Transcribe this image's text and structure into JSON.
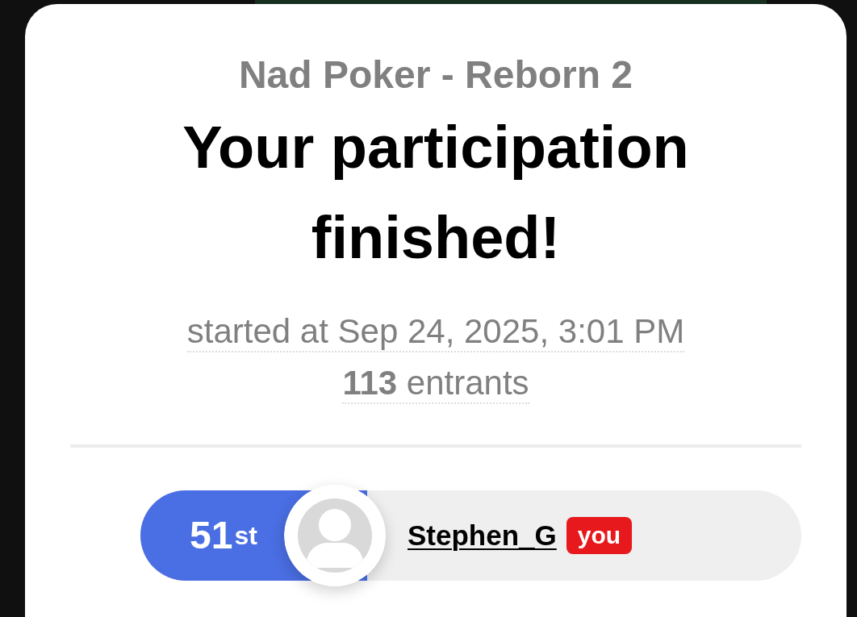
{
  "tournament": {
    "name": "Nad Poker - Reborn 2",
    "heading": "Your participation finished!",
    "started": "started at Sep 24, 2025, 3:01 PM",
    "entrants": "**113** entrants"
  },
  "result": {
    "rank": "51",
    "rank_suffix": "st",
    "player": "Stephen_G",
    "badge": "you"
  }
}
